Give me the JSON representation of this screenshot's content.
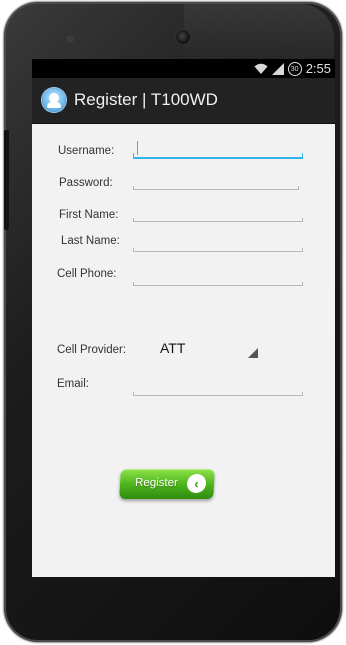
{
  "status_bar": {
    "battery_level": "30",
    "time": "2:55",
    "icons": [
      "wifi-icon",
      "signal-icon",
      "battery-icon"
    ]
  },
  "action_bar": {
    "title": "Register | T100WD",
    "icon": "app-icon"
  },
  "form": {
    "username": {
      "label": "Username:",
      "value": ""
    },
    "password": {
      "label": "Password:",
      "value": ""
    },
    "first_name": {
      "label": "First Name:",
      "value": ""
    },
    "last_name": {
      "label": "Last Name:",
      "value": ""
    },
    "cell_phone": {
      "label": "Cell Phone:",
      "value": ""
    },
    "cell_provider": {
      "label": "Cell Provider:",
      "selected": "ATT"
    },
    "email": {
      "label": "Email:",
      "value": ""
    }
  },
  "register_button": {
    "label": "Register",
    "icon": "chevron-left-icon"
  },
  "colors": {
    "accent": "#33b5e5",
    "button_green": "#4fb51d",
    "action_bar": "#222222"
  }
}
